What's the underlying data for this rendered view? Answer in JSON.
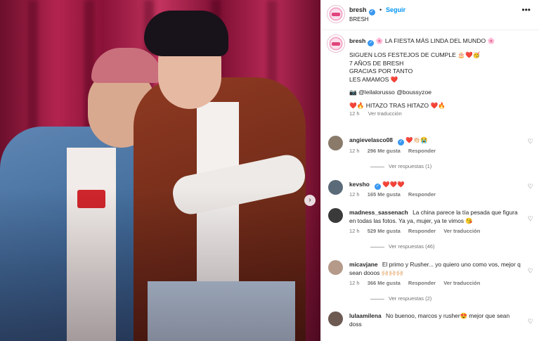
{
  "photo": {
    "next_icon": "chevron-right-icon",
    "next_glyph": "›"
  },
  "header": {
    "username": "bresh",
    "verified_glyph": "✓",
    "dot": "•",
    "follow_label": "Seguir",
    "subtitle": "BRESH",
    "more_glyph": "•••"
  },
  "caption": {
    "username": "bresh",
    "title": "🌸 LA FIESTA MÁS LINDA DEL MUNDO 🌸",
    "line1": "SIGUEN LOS FESTEJOS DE CUMPLE 🎂❤️🥳",
    "line2": "7 AÑOS DE BRESH",
    "line3": "GRACIAS POR TANTO",
    "line4": "LES AMAMOS ❤️",
    "credits": "📷 @leilalorusso @boussyzoe",
    "hitazo": "❤️🔥 HITAZO TRAS HITAZO ❤️🔥",
    "time": "12 h",
    "translate": "Ver traducción"
  },
  "comments": [
    {
      "username": "angievelasco08",
      "text": "❤️👏🏻😭",
      "time": "12 h",
      "likes": "296 Me gusta",
      "reply": "Responder",
      "translate": "",
      "replies": "Ver respuestas (1)",
      "avatar_color": "#8a7a6a"
    },
    {
      "username": "kevsho",
      "text": "❤️❤️❤️",
      "time": "12 h",
      "likes": "165 Me gusta",
      "reply": "Responder",
      "translate": "",
      "replies": "",
      "avatar_color": "#5a6a78"
    },
    {
      "username": "madness_sassenach",
      "text": "La china parece la tía pesada que figura en todas las fotos. Ya ya, mujer, ya te vimos 😘",
      "time": "12 h",
      "likes": "529 Me gusta",
      "reply": "Responder",
      "translate": "Ver traducción",
      "replies": "Ver respuestas (46)",
      "avatar_color": "#3a3a3a"
    },
    {
      "username": "micavjane",
      "text": "El primo y Rusher... yo quiero uno como vos, mejor q sean dooos 🙌🏻🙌🏻🙌🏻",
      "time": "12 h",
      "likes": "366 Me gusta",
      "reply": "Responder",
      "translate": "Ver traducción",
      "replies": "Ver respuestas (2)",
      "avatar_color": "#b59a8a"
    },
    {
      "username": "lulaamilena",
      "text": "No buenoo, marcos y rusher😍 mejor que sean doss",
      "time": "",
      "likes": "",
      "reply": "",
      "translate": "",
      "replies": "",
      "avatar_color": "#6d5a52"
    }
  ],
  "heart_glyph": "♡",
  "colors": {
    "link_blue": "#0095f6",
    "verified_blue": "#3897f0",
    "muted": "#737373",
    "curtain": "#b3244f"
  }
}
